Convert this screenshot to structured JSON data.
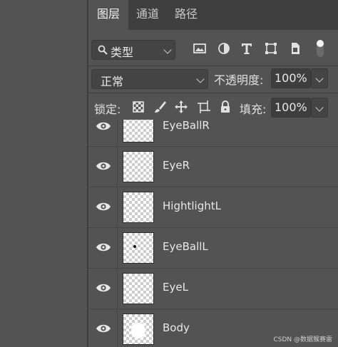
{
  "tabs": [
    {
      "label": "图层",
      "active": true
    },
    {
      "label": "通道",
      "active": false
    },
    {
      "label": "路径",
      "active": false
    }
  ],
  "filter": {
    "kind_label": "类型"
  },
  "blend": {
    "mode": "正常",
    "opacity_label": "不透明度:",
    "opacity_value": "100%"
  },
  "lock": {
    "label": "锁定:",
    "fill_label": "填充:",
    "fill_value": "100%"
  },
  "layers": [
    {
      "name": "EyeBallR"
    },
    {
      "name": "EyeR"
    },
    {
      "name": "HightlightL"
    },
    {
      "name": "EyeBallL"
    },
    {
      "name": "EyeL"
    },
    {
      "name": "Body"
    }
  ],
  "watermark": "CSDN @数据猴赛雷",
  "colors": {
    "panel": "#535353",
    "tabbar": "#3f3f3f",
    "field": "#444444"
  }
}
